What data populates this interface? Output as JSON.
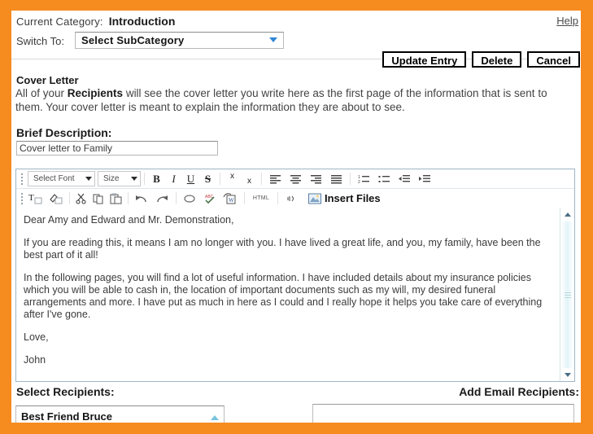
{
  "theme": {
    "frame_color": "#f68b1f",
    "page_bg": "#ffffff",
    "accent_blue": "#2f86d6"
  },
  "header": {
    "current_category_label": "Current Category:",
    "current_category_value": "Introduction",
    "help_label": "Help",
    "switch_to_label": "Switch To:",
    "subcategory_value": "Select SubCategory"
  },
  "actions": {
    "update_label": "Update Entry",
    "delete_label": "Delete",
    "cancel_label": "Cancel"
  },
  "cover_letter": {
    "heading": "Cover Letter",
    "intro_part1": "All of your ",
    "intro_bold": "Recipients",
    "intro_part2": " will see the cover letter you write here as the first page of the information that is sent to them. Your cover letter is meant to explain the information they are about to see."
  },
  "brief_description": {
    "label": "Brief Description:",
    "value": "Cover letter to Family",
    "placeholder": "Cover letter to Family"
  },
  "editor": {
    "font_select_label": "Select Font",
    "size_select_label": "Size",
    "bold_label": "B",
    "italic_label": "I",
    "underline_label": "U",
    "strike_label": "S",
    "superscript_label": "x",
    "subscript_label": "x",
    "html_label": "HTML",
    "insert_files_label": "Insert Files",
    "content": {
      "p1": "Dear Amy and Edward and Mr. Demonstration,",
      "p2": "If you are reading this, it means I am no longer with you. I have lived a great life, and you, my family, have been the best part of it all!",
      "p3": "In the following pages, you will find a lot of useful information. I have included details about my insurance policies which you will be able to cash in, the location of important documents such as my will, my desired funeral arrangements and more. I have put as much in here as I could and I really hope it helps you take care of everything after I've gone.",
      "p4": "Love,",
      "p5": "John"
    }
  },
  "recipients": {
    "select_label": "Select Recipients:",
    "selected_item": "Best Friend Bruce",
    "add_email_label": "Add Email Recipients:",
    "email_value": ""
  }
}
